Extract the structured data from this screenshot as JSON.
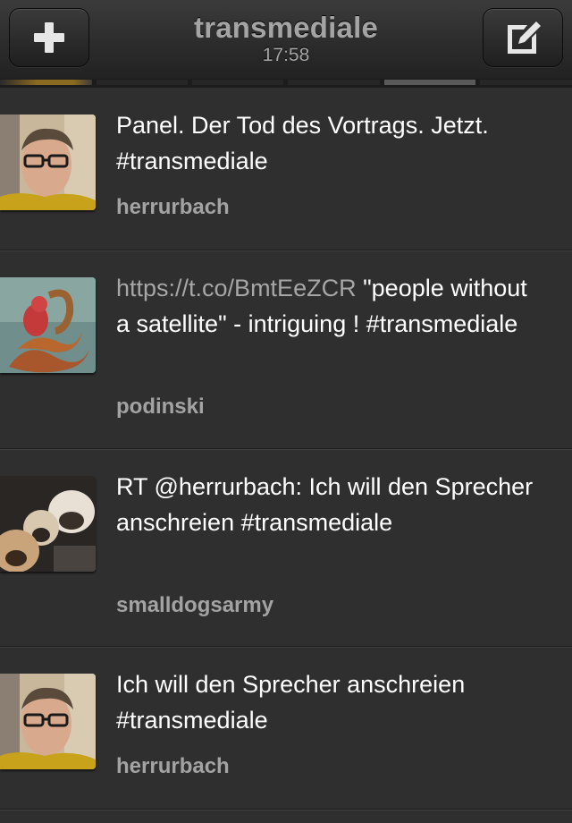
{
  "header": {
    "title": "transmediale",
    "subtitle": "17:58",
    "left_icon": "plus-icon",
    "right_icon": "compose-icon"
  },
  "pager": {
    "pages": 6,
    "active_index": 4
  },
  "tweets": [
    {
      "avatar": "avatar-man-glasses",
      "link": "",
      "text": "Panel. Der Tod des Vortrags. Jetzt. #transmediale",
      "author": "herrurbach"
    },
    {
      "avatar": "avatar-snake-creature",
      "link": "https://t.co/BmtEeZCR",
      "text": " \"people without a satellite\" - intriguing ! #transmediale",
      "author": "podinski"
    },
    {
      "avatar": "avatar-pug-dogs",
      "link": "",
      "text": "RT @herrurbach: Ich will den Sprecher anschreien #transmediale",
      "author": "smalldogsarmy"
    },
    {
      "avatar": "avatar-man-glasses",
      "link": "",
      "text": "Ich will den Sprecher anschreien #transmediale",
      "author": "herrurbach"
    }
  ],
  "colors": {
    "background": "#2f2f2f",
    "text": "#ffffff",
    "muted": "#a3a3a3"
  }
}
